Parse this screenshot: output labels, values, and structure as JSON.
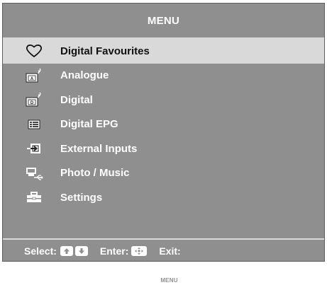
{
  "header": {
    "title": "MENU"
  },
  "menu": {
    "items": [
      {
        "label": "Digital Favourites",
        "icon": "heart-icon",
        "selected": true
      },
      {
        "label": "Analogue",
        "icon": "analogue-tv-icon",
        "selected": false
      },
      {
        "label": "Digital",
        "icon": "digital-tv-icon",
        "selected": false
      },
      {
        "label": "Digital EPG",
        "icon": "epg-guide-icon",
        "selected": false
      },
      {
        "label": "External Inputs",
        "icon": "external-input-icon",
        "selected": false
      },
      {
        "label": "Photo / Music",
        "icon": "usb-media-icon",
        "selected": false
      },
      {
        "label": "Settings",
        "icon": "toolbox-icon",
        "selected": false
      }
    ]
  },
  "footer": {
    "select_label": "Select:",
    "enter_label": "Enter:",
    "exit_label": "Exit:",
    "menu_key_label": "MENU"
  },
  "colors": {
    "panel": "#8f8f8f",
    "highlight": "#d9d9d9",
    "text": "#ffffff",
    "selected_text": "#111111"
  }
}
